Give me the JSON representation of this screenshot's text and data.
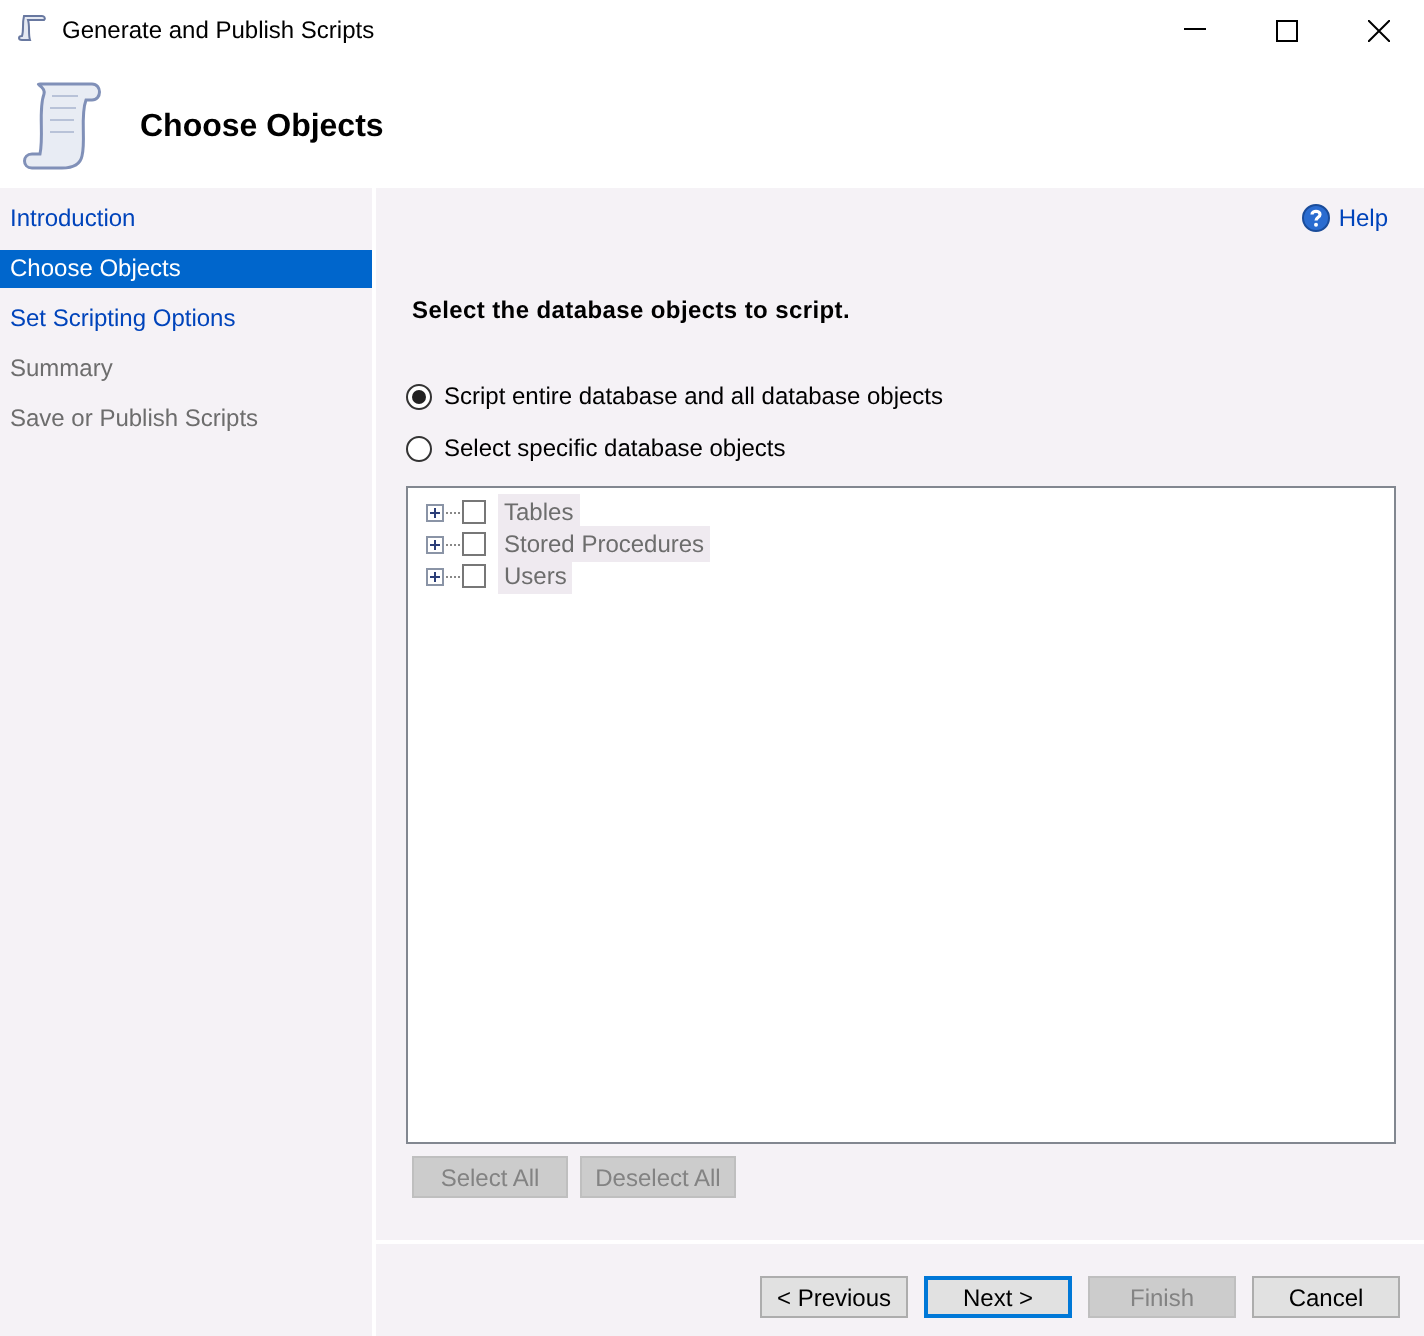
{
  "window": {
    "title": "Generate and Publish Scripts"
  },
  "header": {
    "title": "Choose Objects"
  },
  "sidebar": {
    "items": [
      {
        "label": "Introduction",
        "selected": false,
        "disabled": false
      },
      {
        "label": "Choose Objects",
        "selected": true,
        "disabled": false
      },
      {
        "label": "Set Scripting Options",
        "selected": false,
        "disabled": false
      },
      {
        "label": "Summary",
        "selected": false,
        "disabled": true
      },
      {
        "label": "Save or Publish Scripts",
        "selected": false,
        "disabled": true
      }
    ]
  },
  "help": {
    "label": "Help"
  },
  "heading": "Select the database objects to script.",
  "options": [
    {
      "label": "Script entire database and all database objects",
      "selected": true
    },
    {
      "label": "Select specific database objects",
      "selected": false
    }
  ],
  "tree": {
    "disabled": true,
    "items": [
      {
        "label": "Tables",
        "checked": false,
        "expanded": false
      },
      {
        "label": "Stored Procedures",
        "checked": false,
        "expanded": false
      },
      {
        "label": "Users",
        "checked": false,
        "expanded": false
      }
    ]
  },
  "tree_buttons": [
    {
      "label": "Select All",
      "disabled": true
    },
    {
      "label": "Deselect All",
      "disabled": true
    }
  ],
  "footer_buttons": [
    {
      "label": "< Previous",
      "disabled": false,
      "default": false
    },
    {
      "label": "Next >",
      "disabled": false,
      "default": true
    },
    {
      "label": "Finish",
      "disabled": true,
      "default": false
    },
    {
      "label": "Cancel",
      "disabled": false,
      "default": false
    }
  ]
}
